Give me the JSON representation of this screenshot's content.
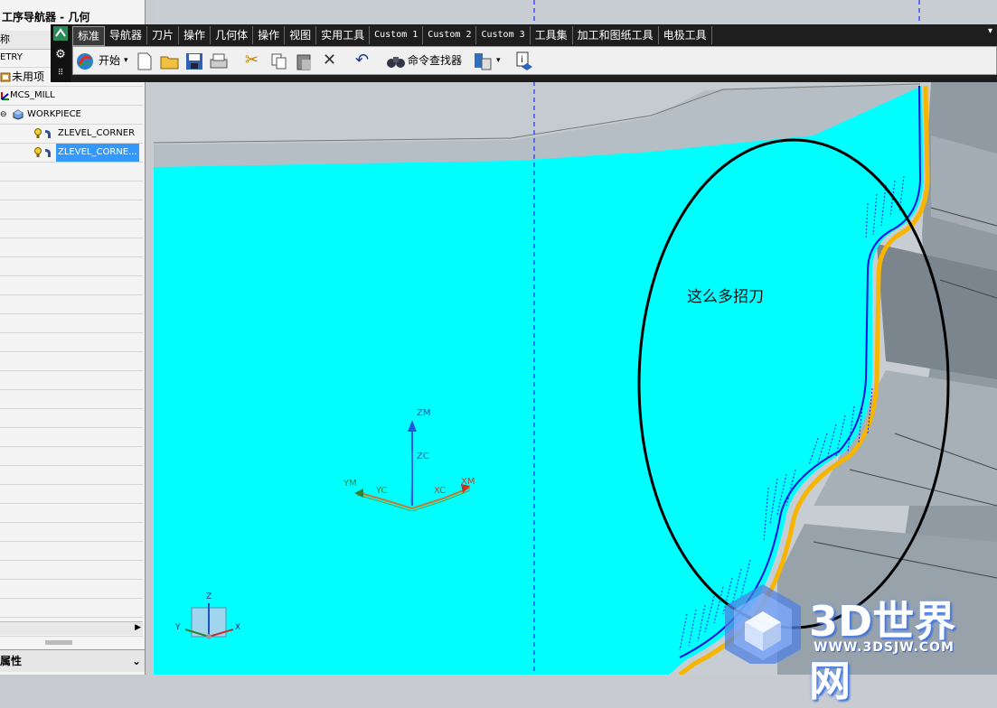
{
  "navigator": {
    "title": "工序导航器 - 几何",
    "header_col": "称",
    "rows": [
      {
        "label": "ETRY"
      },
      {
        "label": "未用项"
      },
      {
        "label": "MCS_MILL"
      },
      {
        "label": "WORKPIECE"
      },
      {
        "label": "ZLEVEL_CORNER"
      },
      {
        "label": "ZLEVEL_CORNE..."
      }
    ],
    "properties_label": "属性"
  },
  "menu": {
    "tabs": [
      "标准",
      "导航器",
      "刀片",
      "操作",
      "几何体",
      "操作",
      "视图",
      "实用工具",
      "Custom 1",
      "Custom 2",
      "Custom 3",
      "工具集",
      "加工和图纸工具",
      "电极工具"
    ],
    "active_tab": "标准"
  },
  "toolbar": {
    "start_label": "开始",
    "command_finder_label": "命令查找器"
  },
  "viewport": {
    "annotation": "这么多招刀",
    "triad_labels": {
      "zm": "ZM",
      "zc": "ZC",
      "ym": "YM",
      "yc": "YC",
      "xc": "XC",
      "xm": "XM"
    },
    "mini_triad": {
      "z": "Z",
      "y": "Y",
      "x": "X"
    },
    "colors": {
      "cyan_face": "#00ffff",
      "tool_path_blue": "#0010e0",
      "edge_yellow": "#f7b500",
      "background": "#c7cdd2"
    }
  },
  "watermark": {
    "text": "3D世界网",
    "url": "WWW.3DSJW.COM"
  }
}
